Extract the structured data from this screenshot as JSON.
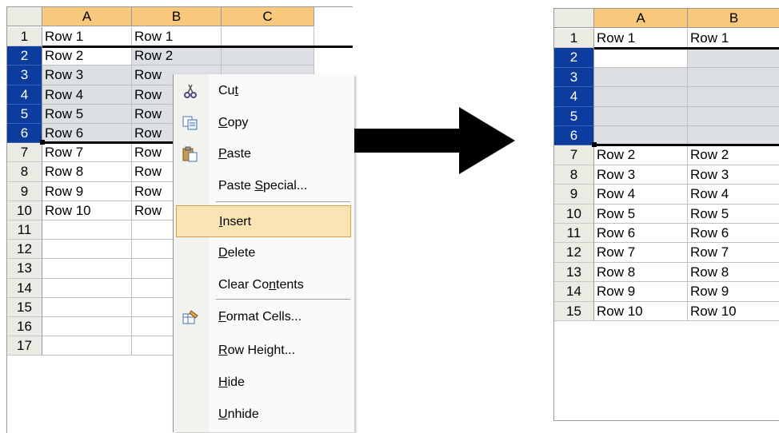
{
  "left_sheet": {
    "columns": [
      "A",
      "B",
      "C"
    ],
    "row_numbers": [
      "1",
      "2",
      "3",
      "4",
      "5",
      "6",
      "7",
      "8",
      "9",
      "10",
      "11",
      "12",
      "13",
      "14",
      "15",
      "16",
      "17"
    ],
    "selected_rows": [
      "2",
      "3",
      "4",
      "5",
      "6"
    ],
    "col_a": [
      "Row 1",
      "Row 2",
      "Row 3",
      "Row 4",
      "Row 5",
      "Row 6",
      "Row 7",
      "Row 8",
      "Row 9",
      "Row 10"
    ],
    "col_b": [
      "Row 1",
      "Row 2",
      "Row",
      "Row",
      "Row",
      "Row",
      "Row",
      "Row",
      "Row",
      "Row"
    ]
  },
  "context_menu": {
    "items": [
      {
        "pre": "Cu",
        "key": "t",
        "post": "",
        "icon": "scissors-icon"
      },
      {
        "pre": "",
        "key": "C",
        "post": "opy",
        "icon": "copy-icon"
      },
      {
        "pre": "",
        "key": "P",
        "post": "aste",
        "icon": "paste-icon"
      },
      {
        "pre": "Paste ",
        "key": "S",
        "post": "pecial...",
        "icon": ""
      },
      {
        "pre": "",
        "key": "I",
        "post": "nsert",
        "icon": "",
        "highlighted": true
      },
      {
        "pre": "",
        "key": "D",
        "post": "elete",
        "icon": ""
      },
      {
        "pre": "Clear Co",
        "key": "n",
        "post": "tents",
        "icon": ""
      },
      {
        "pre": "",
        "key": "F",
        "post": "ormat Cells...",
        "icon": "format-cells-icon"
      },
      {
        "pre": "",
        "key": "R",
        "post": "ow Height...",
        "icon": ""
      },
      {
        "pre": "",
        "key": "H",
        "post": "ide",
        "icon": ""
      },
      {
        "pre": "",
        "key": "U",
        "post": "nhide",
        "icon": ""
      }
    ]
  },
  "right_sheet": {
    "columns": [
      "A",
      "B"
    ],
    "row_numbers": [
      "1",
      "2",
      "3",
      "4",
      "5",
      "6",
      "7",
      "8",
      "9",
      "10",
      "11",
      "12",
      "13",
      "14",
      "15"
    ],
    "selected_rows": [
      "2",
      "3",
      "4",
      "5",
      "6"
    ],
    "col_a": [
      "Row 1",
      "",
      "",
      "",
      "",
      "",
      "Row 2",
      "Row 3",
      "Row 4",
      "Row 5",
      "Row 6",
      "Row 7",
      "Row 8",
      "Row 9",
      "Row 10"
    ],
    "col_b": [
      "Row 1",
      "",
      "",
      "",
      "",
      "",
      "Row 2",
      "Row 3",
      "Row 4",
      "Row 5",
      "Row 6",
      "Row 7",
      "Row 8",
      "Row 9",
      "Row 10"
    ]
  },
  "colors": {
    "column_header": "#f8c87c",
    "row_header": "#ebeae3",
    "selected_row_header": "#0b3c9e",
    "selected_cell": "#dcdfe4",
    "menu_highlight": "#fae4b4"
  }
}
